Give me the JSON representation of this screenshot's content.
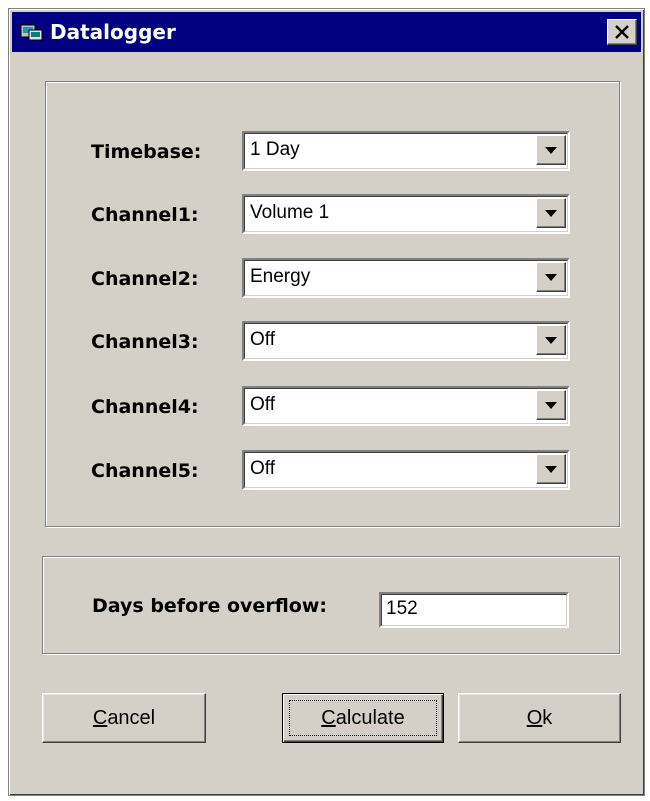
{
  "window": {
    "title": "Datalogger"
  },
  "channels": [
    {
      "label": "Timebase:",
      "value": "1 Day"
    },
    {
      "label": "Channel1:",
      "value": "Volume 1"
    },
    {
      "label": "Channel2:",
      "value": "Energy"
    },
    {
      "label": "Channel3:",
      "value": "Off"
    },
    {
      "label": "Channel4:",
      "value": "Off"
    },
    {
      "label": "Channel5:",
      "value": "Off"
    }
  ],
  "overflow": {
    "label": "Days before overflow:",
    "value": "152"
  },
  "buttons": {
    "cancel": {
      "mnemonic": "C",
      "rest": "ancel"
    },
    "calculate": {
      "mnemonic": "C",
      "rest": "alculate"
    },
    "ok": {
      "mnemonic": "O",
      "rest": "k"
    }
  },
  "icons": {
    "app": "datalogger-app-icon",
    "close": "close-icon",
    "dropdown": "dropdown-arrow-icon"
  },
  "colors": {
    "titlebar": "#000080",
    "face": "#d4d0c8",
    "field": "#ffffff"
  }
}
